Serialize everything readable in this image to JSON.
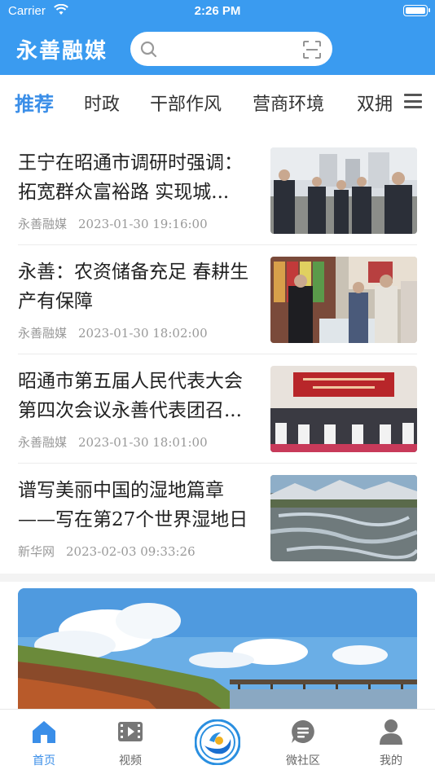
{
  "status_bar": {
    "carrier": "Carrier",
    "time": "2:26 PM"
  },
  "header": {
    "app_title": "永善融媒"
  },
  "tabs": [
    {
      "label": "推荐",
      "active": true
    },
    {
      "label": "时政"
    },
    {
      "label": "干部作风"
    },
    {
      "label": "营商环境"
    },
    {
      "label": "双拥"
    }
  ],
  "news": [
    {
      "title": "王宁在昭通市调研时强调：拓宽群众富裕路 实现城...",
      "source": "永善融媒",
      "time": "2023-01-30 19:16:00"
    },
    {
      "title": "永善：农资储备充足 春耕生产有保障",
      "source": "永善融媒",
      "time": "2023-01-30 18:02:00"
    },
    {
      "title": "昭通市第五届人民代表大会第四次会议永善代表团召...",
      "source": "永善融媒",
      "time": "2023-01-30 18:01:00"
    },
    {
      "title": "谱写美丽中国的湿地篇章——写在第27个世界湿地日",
      "source": "新华网",
      "time": "2023-02-03 09:33:26"
    }
  ],
  "bottom_nav": [
    {
      "label": "首页",
      "icon": "home-icon",
      "active": true
    },
    {
      "label": "视频",
      "icon": "video-icon"
    },
    {
      "label": "",
      "icon": "center-logo-icon"
    },
    {
      "label": "微社区",
      "icon": "community-icon"
    },
    {
      "label": "我的",
      "icon": "profile-icon"
    }
  ],
  "colors": {
    "brand": "#3a9bf0",
    "active_tab": "#3a8ee8",
    "meta_text": "#999999"
  }
}
